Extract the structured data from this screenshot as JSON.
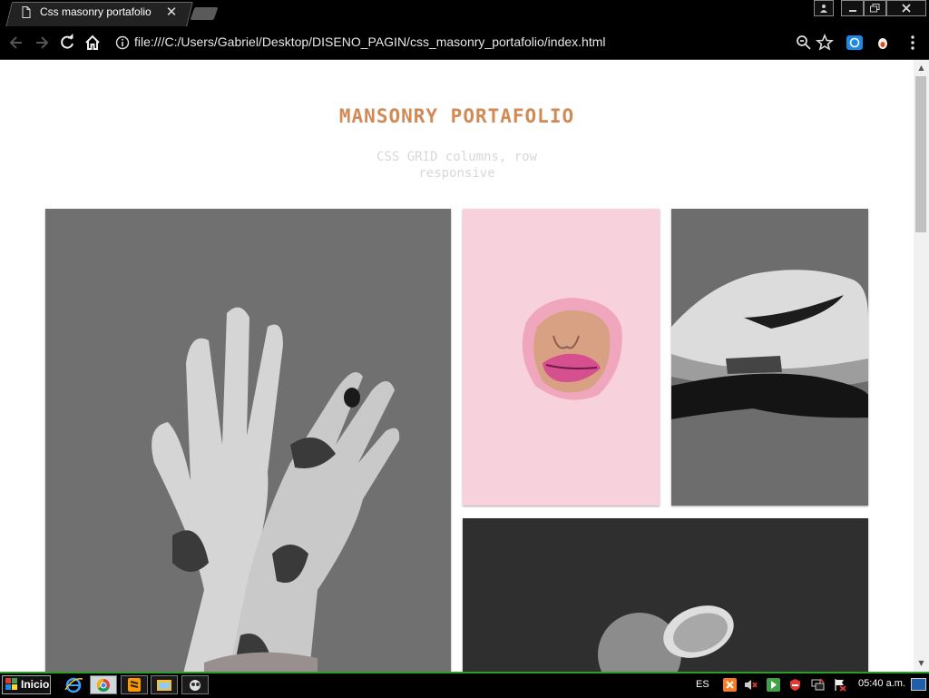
{
  "browser": {
    "tab_title": "Css masonry portafolio",
    "url": "file:///C:/Users/Gabriel/Desktop/DISENO_PAGIN/css_masonry_portafolio/index.html",
    "icons": [
      "back-icon",
      "forward-icon",
      "reload-icon",
      "home-icon",
      "info-icon",
      "zoom-icon",
      "star-icon",
      "extension-icon",
      "extension-icon-2",
      "menu-icon"
    ]
  },
  "page": {
    "title": "MANSONRY PORTAFOLIO",
    "subtitle": "CSS GRID columns, row responsive",
    "title_color": "#d18a55",
    "images": [
      "hands-glitter-image",
      "pink-lips-image",
      "sneaker-image",
      "orange-image"
    ]
  },
  "taskbar": {
    "start_label": "Inicio",
    "language": "ES",
    "clock": "05:40 a.m.",
    "accent_color": "#2aa02a"
  }
}
